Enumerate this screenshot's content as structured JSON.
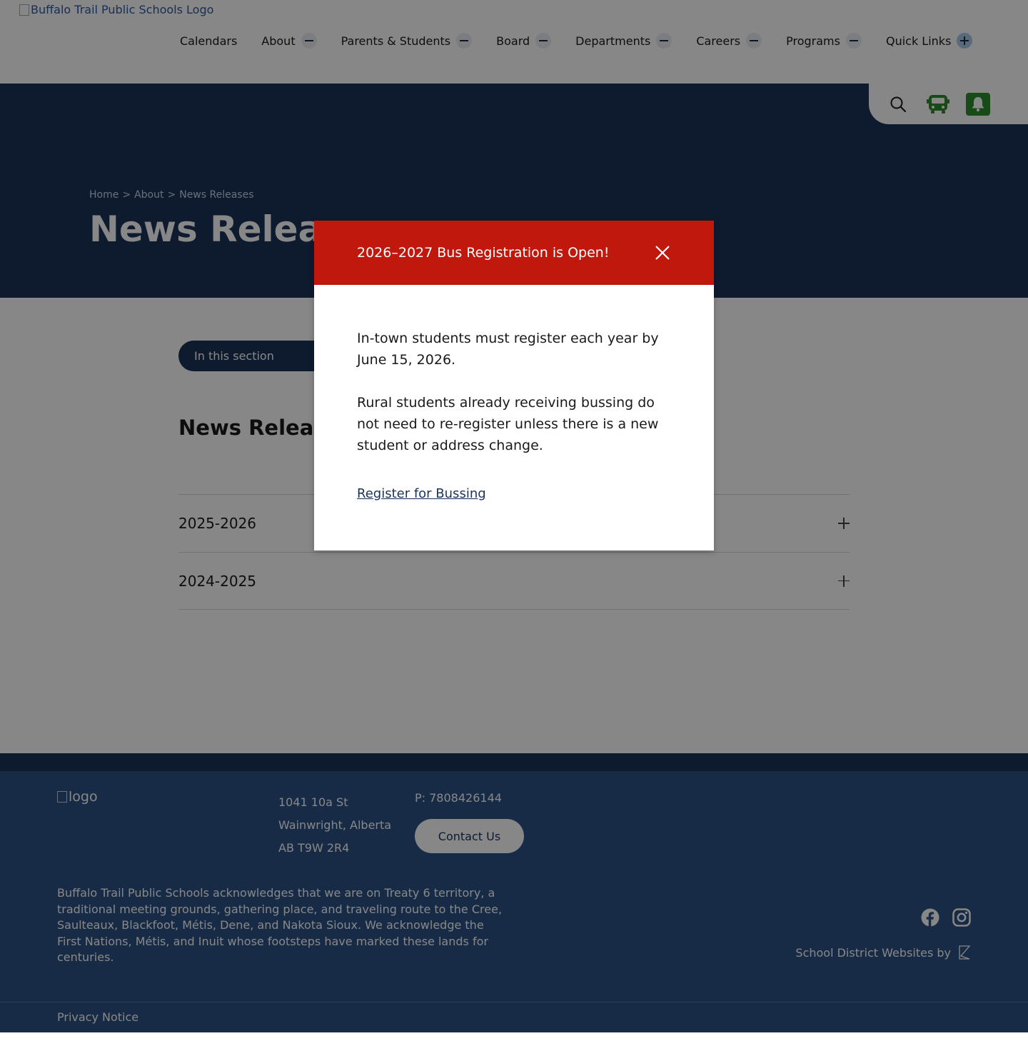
{
  "header": {
    "logo_alt": "Buffalo Trail Public Schools Logo",
    "nav": [
      {
        "label": "Calendars"
      },
      {
        "label": "About"
      },
      {
        "label": "Parents & Students"
      },
      {
        "label": "Board"
      },
      {
        "label": "Departments"
      },
      {
        "label": "Careers"
      },
      {
        "label": "Programs"
      },
      {
        "label": "Quick Links"
      }
    ],
    "utility": {
      "icons": [
        "search-icon",
        "bus-icon",
        "bell-icon"
      ],
      "accent_color": "#2f8c2f"
    }
  },
  "hero": {
    "breadcrumb": [
      "Home",
      ">",
      "About",
      ">",
      "News Releases"
    ],
    "title": "News Releases"
  },
  "main": {
    "section_pill": "In this section",
    "heading": "News Releases",
    "accordion": [
      {
        "label": "2025-2026"
      },
      {
        "label": "2024-2025"
      }
    ]
  },
  "modal": {
    "title": "2026–2027 Bus Registration is Open!",
    "paragraph_1": "In-town students must register each year by June 15, 2026.",
    "paragraph_2": "Rural students already receiving bussing do not need to re-register unless there is a new student or address change.",
    "link": "Register for Bussing",
    "header_color": "#c0180c"
  },
  "footer": {
    "logo_alt": "logo",
    "address": [
      "1041 10a St",
      "Wainwright, Alberta",
      "AB T9W 2R4"
    ],
    "phone": "P: 7808426144",
    "contact_button": "Contact Us",
    "acknowledgement": "Buffalo Trail Public Schools acknowledges that we are on Treaty 6 territory, a traditional meeting grounds, gathering place, and traveling route to the Cree, Saulteaux, Blackfoot, Métis, Dene, and Nakota Sioux. We acknowledge the First Nations, Métis, and Inuit whose footsteps have marked these lands for centuries.",
    "social": [
      "facebook-icon",
      "instagram-icon"
    ],
    "credit": "School District Websites by",
    "privacy": "Privacy Notice",
    "brand_color": "#2c5287"
  }
}
